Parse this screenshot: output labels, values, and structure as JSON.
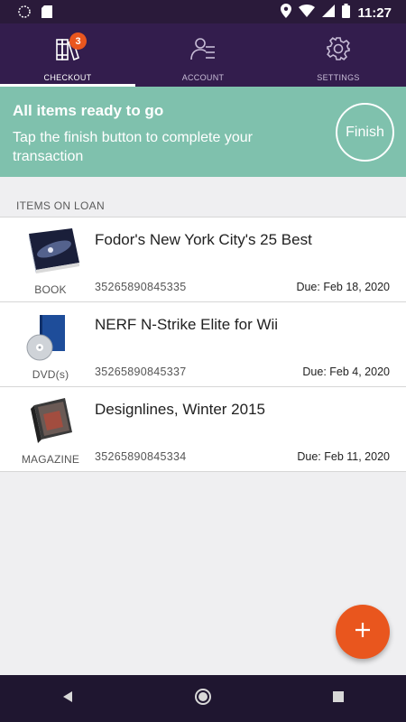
{
  "status_bar": {
    "time": "11:27",
    "icons": [
      "notification-dot-icon",
      "sd-card-icon",
      "location-icon",
      "wifi-icon",
      "cellular-icon",
      "battery-icon"
    ]
  },
  "tabs": [
    {
      "label": "CHECKOUT",
      "icon": "books-icon",
      "badge": "3",
      "active": true
    },
    {
      "label": "ACCOUNT",
      "icon": "user-list-icon",
      "active": false
    },
    {
      "label": "SETTINGS",
      "icon": "gear-icon",
      "active": false
    }
  ],
  "banner": {
    "title": "All items ready to go",
    "text": "Tap the finish button to complete your transaction",
    "finish_label": "Finish"
  },
  "section_header": "ITEMS ON LOAN",
  "items": [
    {
      "title": "Fodor's New York City's 25 Best",
      "type": "BOOK",
      "barcode": "35265890845335",
      "due": "Due: Feb 18, 2020",
      "thumb": "book-icon"
    },
    {
      "title": "NERF N-Strike Elite for Wii",
      "type": "DVD(s)",
      "barcode": "35265890845337",
      "due": "Due: Feb 4, 2020",
      "thumb": "dvd-icon"
    },
    {
      "title": "Designlines, Winter 2015",
      "type": "MAGAZINE",
      "barcode": "35265890845334",
      "due": "Due: Feb 11, 2020",
      "thumb": "magazine-icon"
    }
  ],
  "fab": {
    "icon": "plus-icon"
  },
  "colors": {
    "appbar": "#331d4d",
    "banner": "#7fc1ad",
    "accent": "#e9561e"
  }
}
